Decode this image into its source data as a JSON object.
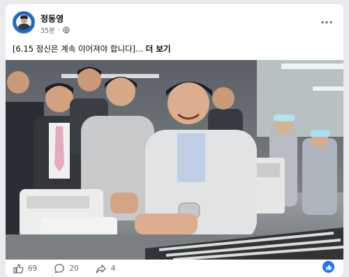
{
  "post": {
    "author": "정동영",
    "time": "35분",
    "separator": "·",
    "caption": "[6.15 정신은 계속 이어져야 합니다]...",
    "see_more": "더 보기"
  },
  "engagement": {
    "likes": "69",
    "comments": "20",
    "shares": "4"
  },
  "icons": {
    "privacy": "globe-icon",
    "more": "more-dots-icon",
    "like": "thumbs-up-icon",
    "comment": "comment-icon",
    "share": "share-icon",
    "reaction": "like-reaction-icon"
  },
  "colors": {
    "facebook_blue": "#1877f2",
    "text_primary": "#050505",
    "text_secondary": "#65676b"
  }
}
